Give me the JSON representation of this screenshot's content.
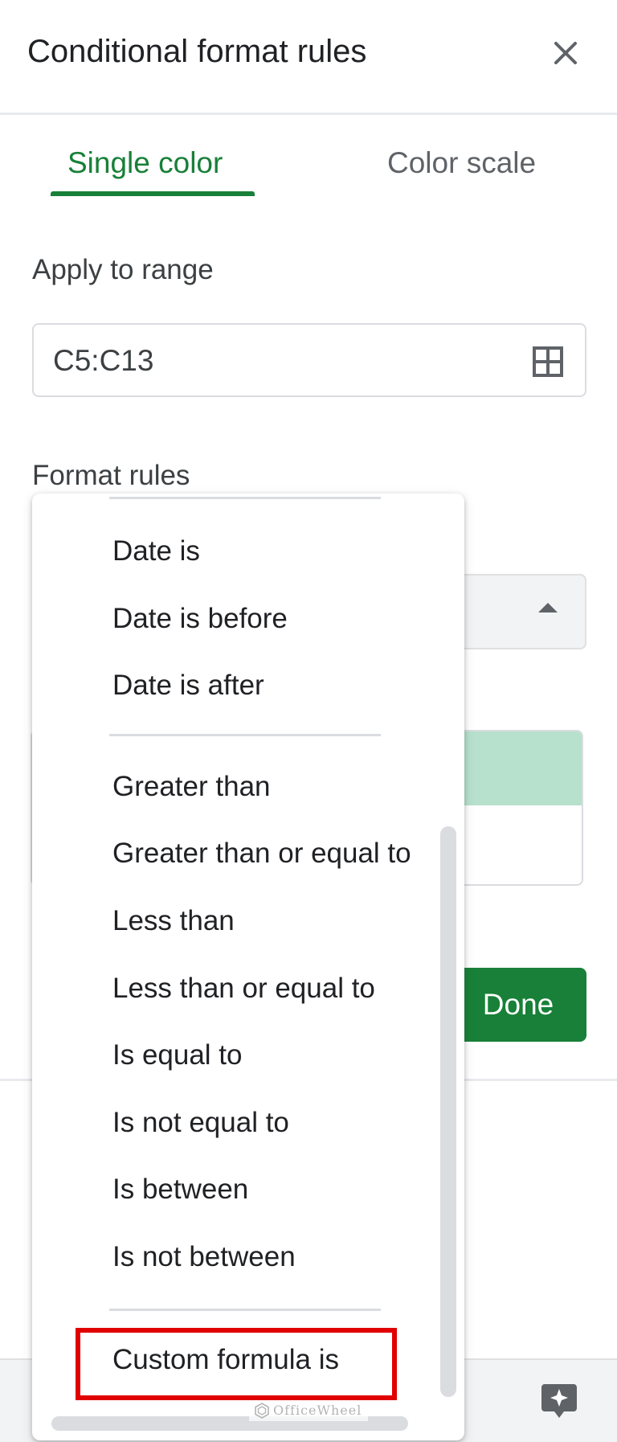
{
  "header": {
    "title": "Conditional format rules",
    "close_icon": "close-icon"
  },
  "tabs": [
    {
      "label": "Single color",
      "active": true
    },
    {
      "label": "Color scale",
      "active": false
    }
  ],
  "range": {
    "label": "Apply to range",
    "value": "C5:C13",
    "icon": "grid-icon"
  },
  "format_rules": {
    "label": "Format rules",
    "preview_color": "#b7e1cd",
    "done_label": "Done"
  },
  "condition_menu": {
    "items": [
      "Date is",
      "Date is before",
      "Date is after",
      "Greater than",
      "Greater than or equal to",
      "Less than",
      "Less than or equal to",
      "Is equal to",
      "Is not equal to",
      "Is between",
      "Is not between",
      "Custom formula is"
    ],
    "highlighted_item": "Custom formula is"
  },
  "watermark": "OfficeWheel",
  "colors": {
    "accent": "#188038",
    "highlight_border": "#e00000"
  }
}
